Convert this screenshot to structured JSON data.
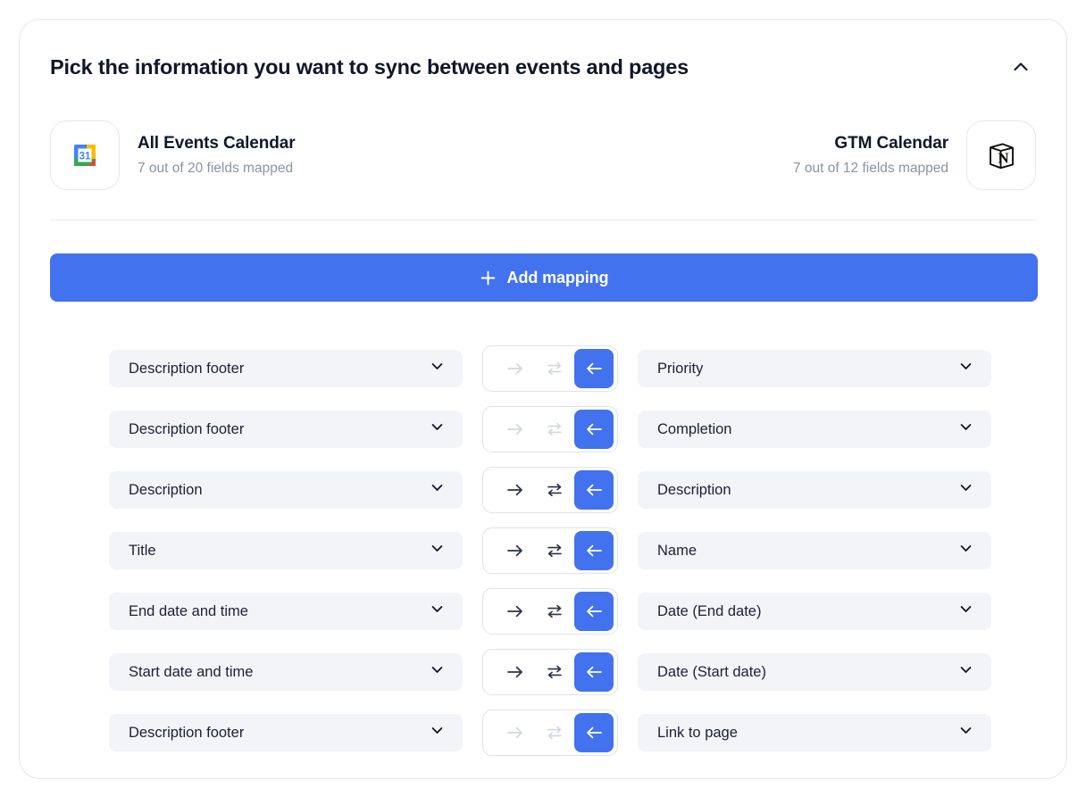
{
  "card": {
    "title": "Pick the information you want to sync between events and pages",
    "collapse_icon": "chevron-up-icon"
  },
  "apps": {
    "left": {
      "name": "All Events Calendar",
      "subtitle": "7 out of 20 fields mapped",
      "logo": "google-calendar-icon",
      "logo_day": "31"
    },
    "right": {
      "name": "GTM Calendar",
      "subtitle": "7 out of 12 fields mapped",
      "logo": "notion-icon",
      "logo_letter": "N"
    }
  },
  "add_mapping": {
    "label": "Add mapping",
    "icon": "plus-icon"
  },
  "colors": {
    "accent": "#4272ed",
    "field_bg": "#f3f4f8",
    "text": "#1b2133",
    "muted": "#8b93a5",
    "arrow_enabled": "#2b3245",
    "arrow_disabled": "#d2d7e0",
    "border": "#e4e7ec"
  },
  "mappings": [
    {
      "source": "Description footer",
      "target": "Priority",
      "direction": "left",
      "to_right_enabled": false,
      "two_way_enabled": false,
      "to_left_enabled": true
    },
    {
      "source": "Description footer",
      "target": "Completion",
      "direction": "left",
      "to_right_enabled": false,
      "two_way_enabled": false,
      "to_left_enabled": true
    },
    {
      "source": "Description",
      "target": "Description",
      "direction": "left",
      "to_right_enabled": true,
      "two_way_enabled": true,
      "to_left_enabled": true
    },
    {
      "source": "Title",
      "target": "Name",
      "direction": "left",
      "to_right_enabled": true,
      "two_way_enabled": true,
      "to_left_enabled": true
    },
    {
      "source": "End date and time",
      "target": "Date (End date)",
      "direction": "left",
      "to_right_enabled": true,
      "two_way_enabled": true,
      "to_left_enabled": true
    },
    {
      "source": "Start date and time",
      "target": "Date (Start date)",
      "direction": "left",
      "to_right_enabled": true,
      "two_way_enabled": true,
      "to_left_enabled": true
    },
    {
      "source": "Description footer",
      "target": "Link to page",
      "direction": "left",
      "to_right_enabled": false,
      "two_way_enabled": false,
      "to_left_enabled": true
    }
  ],
  "icons": {
    "arrow_right": "arrow-right-icon",
    "two_way": "two-way-arrows-icon",
    "arrow_left": "arrow-left-icon",
    "chevron_down": "chevron-down-icon"
  }
}
